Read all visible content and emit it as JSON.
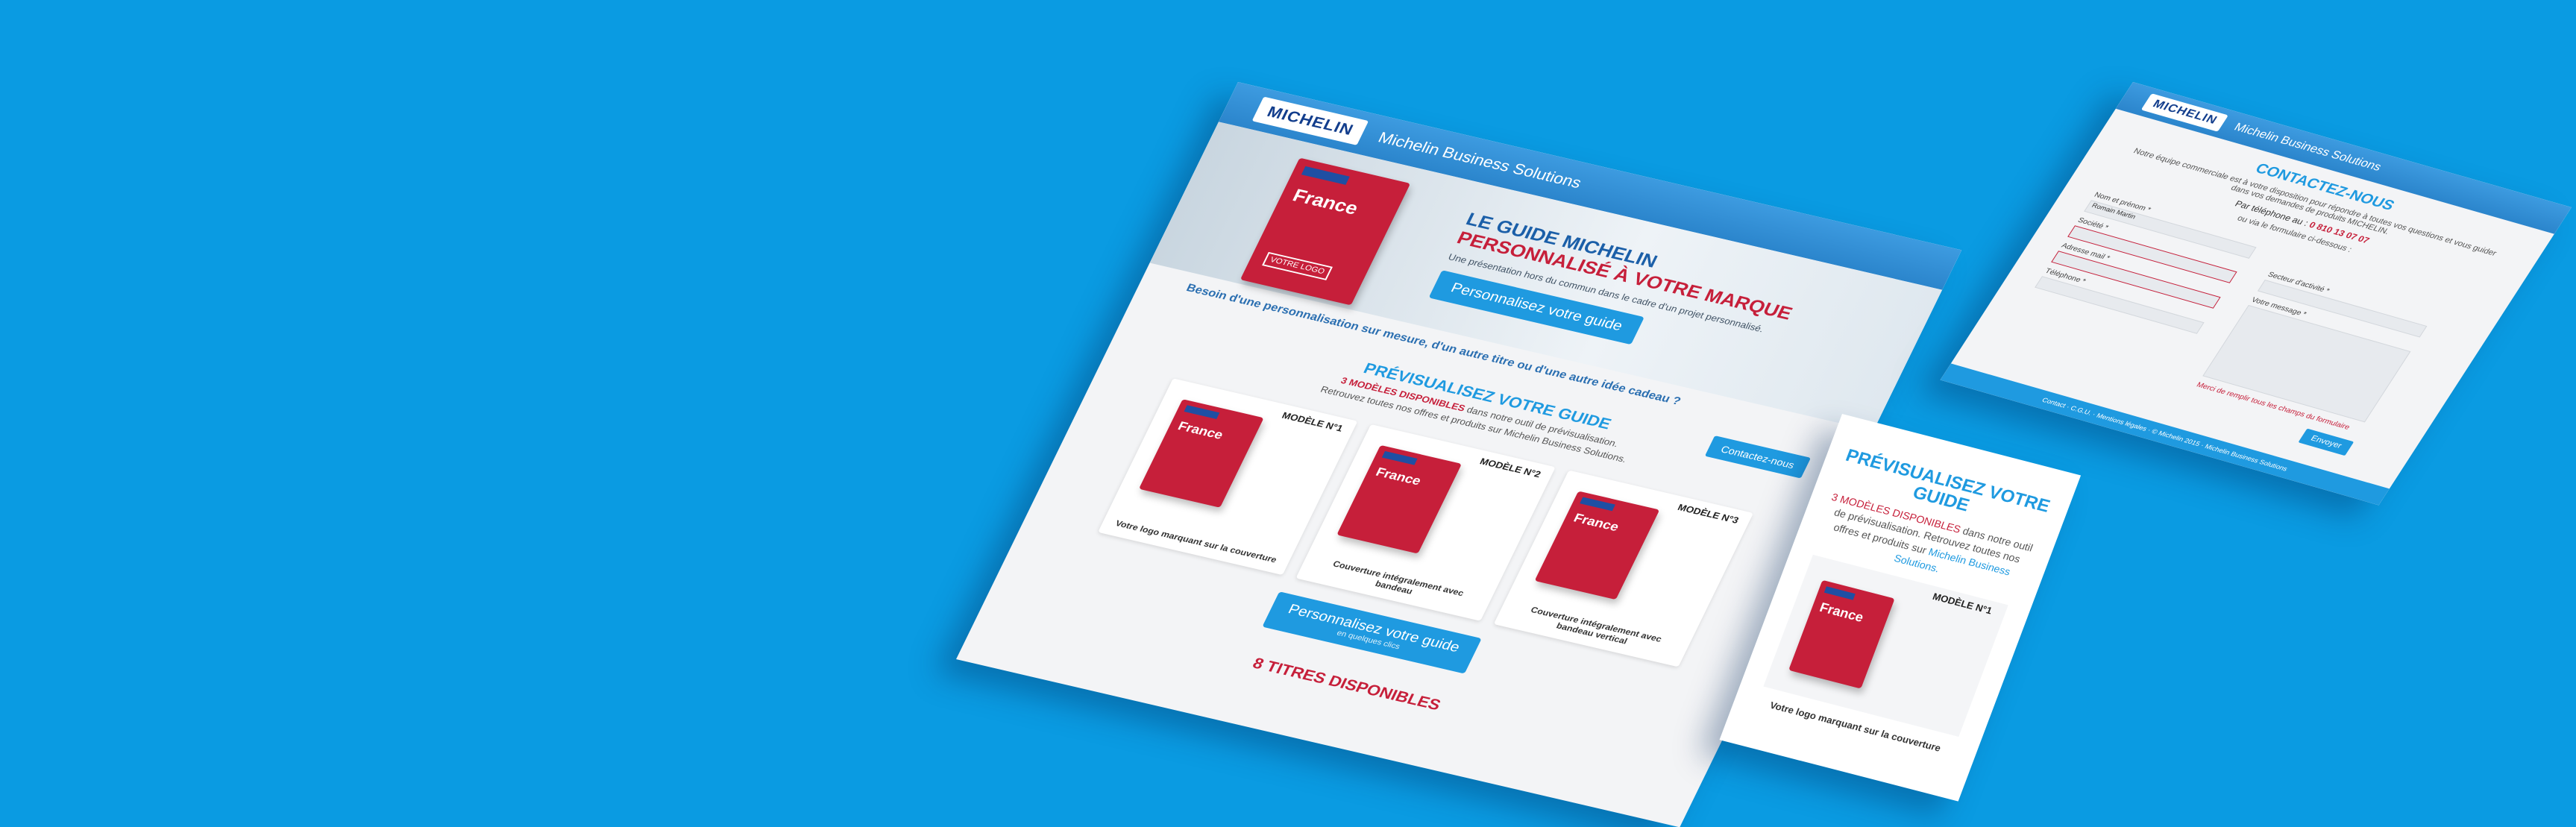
{
  "brand": {
    "logo": "MICHELIN",
    "site_title": "Michelin Business Solutions"
  },
  "desktop": {
    "hero_title_1": "LE GUIDE MICHELIN",
    "hero_title_2": "PERSONNALISÉ À VOTRE MARQUE",
    "hero_desc": "Une présentation hors du commun dans le cadre d'un projet personnalisé.",
    "book_title": "France",
    "book_box": "VOTRE LOGO",
    "intro": "Besoin d'une personnalisation sur mesure, d'un autre titre ou d'une autre idée cadeau ?",
    "cta_hero": "Personnalisez votre guide",
    "section_title": "PRÉVISUALISEZ VOTRE GUIDE",
    "section_sub_hl": "3 MODÈLES DISPONIBLES",
    "section_sub": " dans notre outil de prévisualisation.",
    "section_sub2": "Retrouvez toutes nos offres et produits sur Michelin Business Solutions.",
    "contact_button": "Contactez-nous",
    "models": [
      {
        "label": "MODÈLE N°1",
        "desc": "Votre logo marquant sur la couverture"
      },
      {
        "label": "MODÈLE N°2",
        "desc": "Couverture intégralement avec bandeau"
      },
      {
        "label": "MODÈLE N°3",
        "desc": "Couverture intégralement avec bandeau vertical"
      }
    ],
    "cta_main": "Personnalisez votre guide",
    "cta_main_sub": "en quelques clics",
    "titles": "8 TITRES DISPONIBLES"
  },
  "contact": {
    "title": "CONTACTEZ-NOUS",
    "intro": "Notre équipe commerciale est à votre disposition pour répondre à toutes vos questions et vous guider dans vos demandes de produits MICHELIN.",
    "phone_label": "Par téléphone au :",
    "phone": "0 810 13 07 07",
    "form_note": "ou via le formulaire ci-dessous :",
    "fields": {
      "name": "Nom et prénom *",
      "name_value": "Romain Martin",
      "company": "Société *",
      "email": "Adresse mail *",
      "phone": "Téléphone *",
      "sector": "Secteur d'activité *",
      "message": "Votre message *"
    },
    "error": "Merci de remplir tous les champs du formulaire",
    "send": "Envoyer",
    "footer": "Contact · C.G.U. · Mentions légales · © Michelin 2015 · Michelin Business Solutions"
  },
  "mobile": {
    "title": "PRÉVISUALISEZ VOTRE GUIDE",
    "text_hl": "3 MODÈLES DISPONIBLES",
    "text_1": " dans notre outil de prévisualisation.",
    "text_2": "Retrouvez toutes nos offres et produits sur ",
    "text_link": "Michelin Business Solutions.",
    "model_label": "MODÈLE N°1",
    "book_title": "France",
    "caption": "Votre logo marquant sur la couverture"
  },
  "colors": {
    "background": "#0a9be2",
    "accent_blue": "#1f9ae0",
    "accent_red": "#c61f3a"
  }
}
